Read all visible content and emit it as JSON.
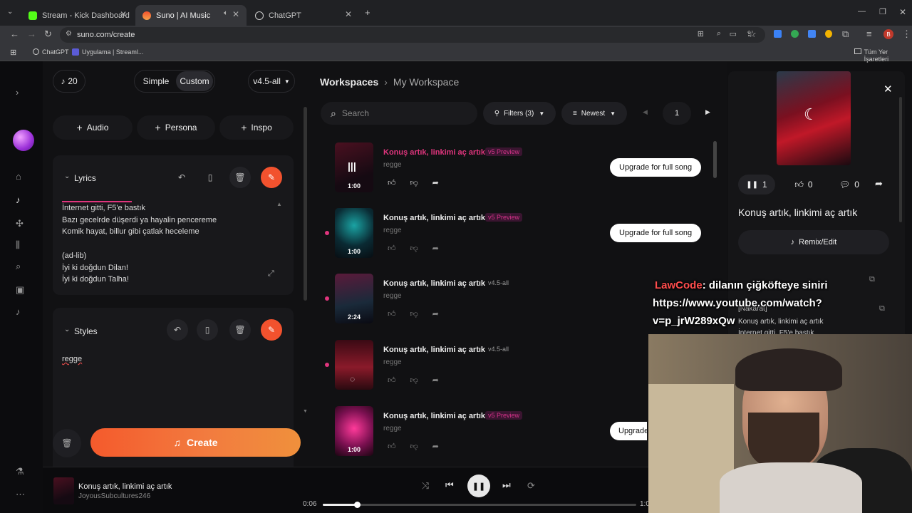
{
  "browser": {
    "tabs": [
      {
        "label": "Stream - Kick Dashboard"
      },
      {
        "label": "Suno | AI Music"
      },
      {
        "label": "ChatGPT"
      }
    ],
    "url": "suno.com/create",
    "bookmarks": [
      {
        "label": "ChatGPT"
      },
      {
        "label": "Uygulama | Streaml..."
      }
    ],
    "all_bookmarks": "Tüm Yer İşaretleri",
    "profile_initial": "B"
  },
  "create": {
    "credits": "20",
    "mode_tabs": [
      "Simple",
      "Custom"
    ],
    "active_mode": "Custom",
    "model": "v4.5-all",
    "add_buttons": [
      "Audio",
      "Persona",
      "Inspo"
    ],
    "lyrics_label": "Lyrics",
    "lyrics_text": "İnternet gitti, F5'e bastık\nBazı gecelrde düşerdi ya hayalin pencereme\nKomik hayat, billur gibi çatlak heceleme\n\n(ad-lib)\nİyi ki doğdun Dilan!\nİyi ki doğdun Talha!",
    "styles_label": "Styles",
    "styles_text": "regge",
    "create_label": "Create"
  },
  "workspace": {
    "breadcrumb_root": "Workspaces",
    "breadcrumb_current": "My Workspace",
    "search_placeholder": "Search",
    "filters_label": "Filters (3)",
    "sort_label": "Newest",
    "page": "1",
    "songs": [
      {
        "title": "Konuş artık, linkimi aç artık",
        "badge": "v5 Preview",
        "genre": "regge",
        "duration": "1:00",
        "upgrade": "Upgrade for full song"
      },
      {
        "title": "Konuş artık, linkimi aç artık",
        "badge": "v5 Preview",
        "genre": "regge",
        "duration": "1:00",
        "upgrade": "Upgrade for full song"
      },
      {
        "title": "Konuş artık, linkimi aç artık",
        "badge": "v4.5-all",
        "genre": "regge",
        "duration": "2:24"
      },
      {
        "title": "Konuş artık, linkimi aç artık",
        "badge": "v4.5-all",
        "genre": "regge"
      },
      {
        "title": "Konuş artık, linkimi aç artık",
        "badge": "v5 Preview",
        "genre": "regge",
        "duration": "1:00",
        "upgrade": "Upgrade"
      }
    ],
    "badge_colors": {
      "v5 Preview": "#d6338a",
      "v4.5-all": "#9a9a9a"
    }
  },
  "detail": {
    "play_count": "1",
    "likes": "0",
    "comments": "0",
    "title": "Konuş artık, linkimi aç artık",
    "remix_label": "Remix/Edit",
    "lyric_tag": "[Nakarat]",
    "lyric_line1": "Konuş artık, linkimi aç artık",
    "lyric_line2": "İnternet gitti, F5'e bastık"
  },
  "chat_overlay": {
    "user": "LawCode",
    "message": ": dilanın çiğköfteye siniri",
    "link1": "https://www.youtube.com/watch?",
    "link2": "v=p_jrW289xQw"
  },
  "player": {
    "title": "Konuş artık, linkimi aç artık",
    "artist": "JoyousSubcultures246",
    "elapsed": "0:06",
    "total": "1:0",
    "progress": 0.11
  },
  "colors": {
    "accent": "#f2522e",
    "pink": "#e0357d"
  }
}
